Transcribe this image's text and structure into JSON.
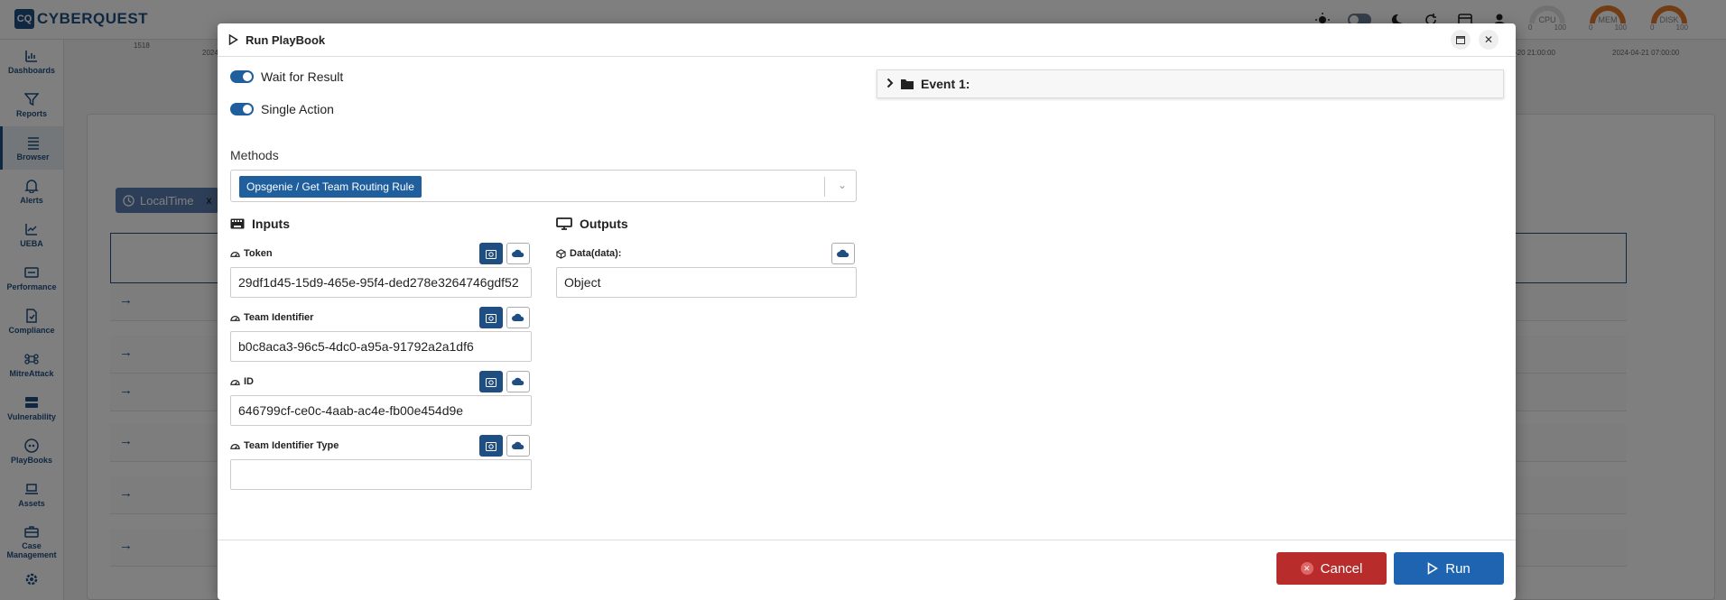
{
  "app": {
    "logo_mark": "CQ",
    "logo_text": "CYBERQUEST",
    "gauges": [
      {
        "label": "CPU",
        "min": "0",
        "max": "100"
      },
      {
        "label": "MEM",
        "min": "0",
        "max": "100"
      },
      {
        "label": "DISK",
        "min": "0",
        "max": "100"
      }
    ],
    "chart_ticks": {
      "y": "1518",
      "x1": "2024",
      "x2": "-20 21:00:00",
      "x3": "2024-04-21 07:00:00"
    }
  },
  "sidebar": {
    "items": [
      {
        "label": "Dashboards",
        "icon": "chart-icon"
      },
      {
        "label": "Reports",
        "icon": "filter-icon"
      },
      {
        "label": "Browser",
        "icon": "list-icon"
      },
      {
        "label": "Alerts",
        "icon": "bell-icon"
      },
      {
        "label": "UEBA",
        "icon": "trend-icon"
      },
      {
        "label": "Performance",
        "icon": "gauge-icon"
      },
      {
        "label": "Compliance",
        "icon": "check-doc-icon"
      },
      {
        "label": "MitreAttack",
        "icon": "command-icon"
      },
      {
        "label": "Vulnerability",
        "icon": "server-icon"
      },
      {
        "label": "PlayBooks",
        "icon": "gamepad-icon"
      },
      {
        "label": "Assets",
        "icon": "laptop-icon"
      },
      {
        "label": "Case Management",
        "icon": "briefcase-icon"
      }
    ]
  },
  "background": {
    "chip_label": "LocalTime",
    "chip_close": "x"
  },
  "modal": {
    "title": "Run PlayBook",
    "wait_for_result_label": "Wait for Result",
    "single_action_label": "Single Action",
    "methods_label": "Methods",
    "method_selected": "Opsgenie / Get Team Routing Rule",
    "inputs_title": "Inputs",
    "outputs_title": "Outputs",
    "inputs": [
      {
        "label": "Token",
        "value": "29df1d45-15d9-465e-95f4-ded278e3264746gdf52"
      },
      {
        "label": "Team Identifier",
        "value": "b0c8aca3-96c5-4dc0-a95a-91792a2a1df6"
      },
      {
        "label": "ID",
        "value": "646799cf-ce0c-4aab-ac4e-fb00e454d9e"
      },
      {
        "label": "Team Identifier Type",
        "value": ""
      }
    ],
    "outputs": [
      {
        "label": "Data(data):",
        "value": "Object"
      }
    ],
    "event_label": "Event 1:",
    "cancel_label": "Cancel",
    "run_label": "Run"
  }
}
